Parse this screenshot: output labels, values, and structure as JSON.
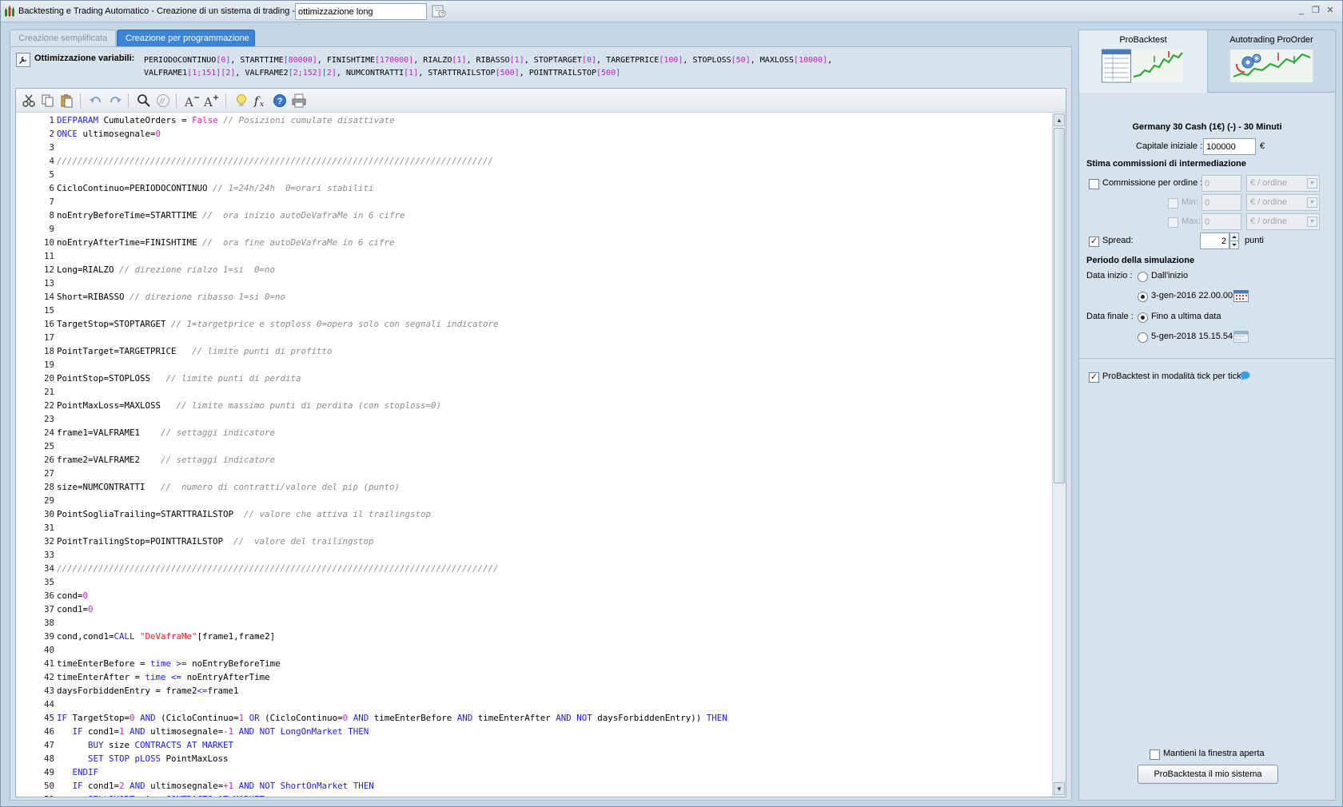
{
  "window": {
    "title": "Backtesting e Trading Automatico - Creazione di un sistema di trading  -",
    "system_name": "ottimizzazione long",
    "controls": {
      "minimize": "_",
      "restore": "❐",
      "close": "✕"
    }
  },
  "tabs": {
    "simple": "Creazione semplificata",
    "programming": "Creazione per programmazione"
  },
  "optimization": {
    "label": "Ottimizzazione variabili:",
    "vars": [
      {
        "name": "PERIODOCONTINUO",
        "value": "[0]"
      },
      {
        "name": "STARTTIME",
        "value": "[80000]"
      },
      {
        "name": "FINISHTIME",
        "value": "[170000]"
      },
      {
        "name": "RIALZO",
        "value": "[1]"
      },
      {
        "name": "RIBASSO",
        "value": "[1]"
      },
      {
        "name": "STOPTARGET",
        "value": "[0]"
      },
      {
        "name": "TARGETPRICE",
        "value": "[100]"
      },
      {
        "name": "STOPLOSS",
        "value": "[50]"
      },
      {
        "name": "MAXLOSS",
        "value": "[10000]"
      },
      {
        "name": "VALFRAME1",
        "value": "[1;151][2]"
      },
      {
        "name": "VALFRAME2",
        "value": "[2;152][2]"
      },
      {
        "name": "NUMCONTRATTI",
        "value": "[1]"
      },
      {
        "name": "STARTTRAILSTOP",
        "value": "[500]"
      },
      {
        "name": "POINTTRAILSTOP",
        "value": "[500]"
      }
    ]
  },
  "code_lines": [
    [
      [
        "kw",
        "DEFPARAM"
      ],
      [
        "t",
        " CumulateOrders "
      ],
      [
        "t",
        "="
      ],
      [
        "t",
        " "
      ],
      [
        "nm",
        "False"
      ],
      [
        "t",
        " "
      ],
      [
        "cm",
        "// Posizioni cumulate disattivate"
      ]
    ],
    [
      [
        "kw",
        "ONCE"
      ],
      [
        "t",
        " ultimosegnale="
      ],
      [
        "nm",
        "0"
      ]
    ],
    [],
    [
      [
        "cm",
        "////////////////////////////////////////////////////////////////////////////////////"
      ]
    ],
    [],
    [
      [
        "t",
        "CicloContinuo=PERIODOCONTINUO "
      ],
      [
        "cm",
        "// 1=24h/24h  0=orari stabiliti"
      ]
    ],
    [],
    [
      [
        "t",
        "noEntryBeforeTime=STARTTIME "
      ],
      [
        "cm",
        "//  ora inizio autoDeVafraMe in 6 cifre"
      ]
    ],
    [],
    [
      [
        "t",
        "noEntryAfterTime=FINISHTIME "
      ],
      [
        "cm",
        "//  ora fine autoDeVafraMe in 6 cifre"
      ]
    ],
    [],
    [
      [
        "t",
        "Long=RIALZO "
      ],
      [
        "cm",
        "// direzione rialzo 1=si  0=no"
      ]
    ],
    [],
    [
      [
        "t",
        "Short=RIBASSO "
      ],
      [
        "cm",
        "// direzione ribasso 1=si 0=no"
      ]
    ],
    [],
    [
      [
        "t",
        "TargetStop=STOPTARGET "
      ],
      [
        "cm",
        "// 1=targetprice e stoploss 0=opera solo con segnali indicatore"
      ]
    ],
    [],
    [
      [
        "t",
        "PointTarget=TARGETPRICE   "
      ],
      [
        "cm",
        "// limite punti di profitto"
      ]
    ],
    [],
    [
      [
        "t",
        "PointStop=STOPLOSS   "
      ],
      [
        "cm",
        "// limite punti di perdita"
      ]
    ],
    [],
    [
      [
        "t",
        "PointMaxLoss=MAXLOSS   "
      ],
      [
        "cm",
        "// limite massimo punti di perdita (con stoploss=0)"
      ]
    ],
    [],
    [
      [
        "t",
        "frame1=VALFRAME1    "
      ],
      [
        "cm",
        "// settaggi indicatore"
      ]
    ],
    [],
    [
      [
        "t",
        "frame2=VALFRAME2    "
      ],
      [
        "cm",
        "// settaggi indicatore"
      ]
    ],
    [],
    [
      [
        "t",
        "size=NUMCONTRATTI   "
      ],
      [
        "cm",
        "//  numero di contratti/valore del pip (punto)"
      ]
    ],
    [],
    [
      [
        "t",
        "PointSogliaTrailing=STARTTRAILSTOP  "
      ],
      [
        "cm",
        "// valore che attiva il trailingstop"
      ]
    ],
    [],
    [
      [
        "t",
        "PointTrailingStop=POINTTRAILSTOP  "
      ],
      [
        "cm",
        "//  valore del trailingstop"
      ]
    ],
    [],
    [
      [
        "cm",
        "/////////////////////////////////////////////////////////////////////////////////////"
      ]
    ],
    [],
    [
      [
        "t",
        "cond="
      ],
      [
        "nm",
        "0"
      ]
    ],
    [
      [
        "t",
        "cond1="
      ],
      [
        "nm",
        "0"
      ]
    ],
    [],
    [
      [
        "t",
        "cond,cond1="
      ],
      [
        "kw",
        "CALL"
      ],
      [
        "t",
        " "
      ],
      [
        "str",
        "\"DeVafraMe\""
      ],
      [
        "t",
        "[frame1,frame2]"
      ]
    ],
    [],
    [
      [
        "t",
        "timeEnterBefore = "
      ],
      [
        "kw",
        "time"
      ],
      [
        "t",
        " "
      ],
      [
        "kw",
        ">="
      ],
      [
        "t",
        " noEntryBeforeTime"
      ]
    ],
    [
      [
        "t",
        "timeEnterAfter = "
      ],
      [
        "kw",
        "time"
      ],
      [
        "t",
        " "
      ],
      [
        "kw",
        "<="
      ],
      [
        "t",
        " noEntryAfterTime"
      ]
    ],
    [
      [
        "t",
        "daysForbiddenEntry = frame2"
      ],
      [
        "kw",
        "<="
      ],
      [
        "t",
        "frame1"
      ]
    ],
    [],
    [
      [
        "kw",
        "IF"
      ],
      [
        "t",
        " TargetStop="
      ],
      [
        "nm",
        "0"
      ],
      [
        "t",
        " "
      ],
      [
        "kw",
        "AND"
      ],
      [
        "t",
        " (CicloContinuo="
      ],
      [
        "nm",
        "1"
      ],
      [
        "t",
        " "
      ],
      [
        "kw",
        "OR"
      ],
      [
        "t",
        " (CicloContinuo="
      ],
      [
        "nm",
        "0"
      ],
      [
        "t",
        " "
      ],
      [
        "kw",
        "AND"
      ],
      [
        "t",
        " timeEnterBefore "
      ],
      [
        "kw",
        "AND"
      ],
      [
        "t",
        " timeEnterAfter "
      ],
      [
        "kw",
        "AND NOT"
      ],
      [
        "t",
        " daysForbiddenEntry)) "
      ],
      [
        "kw",
        "THEN"
      ]
    ],
    [
      [
        "t",
        "   "
      ],
      [
        "kw",
        "IF"
      ],
      [
        "t",
        " cond1="
      ],
      [
        "nm",
        "1"
      ],
      [
        "t",
        " "
      ],
      [
        "kw",
        "AND"
      ],
      [
        "t",
        " ultimosegnale="
      ],
      [
        "nm",
        "-1"
      ],
      [
        "t",
        " "
      ],
      [
        "kw",
        "AND NOT"
      ],
      [
        "t",
        " "
      ],
      [
        "kw",
        "LongOnMarket"
      ],
      [
        "t",
        " "
      ],
      [
        "kw",
        "THEN"
      ]
    ],
    [
      [
        "t",
        "      "
      ],
      [
        "kw",
        "BUY"
      ],
      [
        "t",
        " size "
      ],
      [
        "kw",
        "CONTRACTS AT MARKET"
      ]
    ],
    [
      [
        "t",
        "      "
      ],
      [
        "kw",
        "SET STOP pLOSS"
      ],
      [
        "t",
        " PointMaxLoss"
      ]
    ],
    [
      [
        "t",
        "   "
      ],
      [
        "kw",
        "ENDIF"
      ]
    ],
    [
      [
        "t",
        "   "
      ],
      [
        "kw",
        "IF"
      ],
      [
        "t",
        " cond1="
      ],
      [
        "nm",
        "2"
      ],
      [
        "t",
        " "
      ],
      [
        "kw",
        "AND"
      ],
      [
        "t",
        " ultimosegnale="
      ],
      [
        "nm",
        "+1"
      ],
      [
        "t",
        " "
      ],
      [
        "kw",
        "AND NOT"
      ],
      [
        "t",
        " "
      ],
      [
        "kw",
        "ShortOnMarket"
      ],
      [
        "t",
        " "
      ],
      [
        "kw",
        "THEN"
      ]
    ],
    [
      [
        "t",
        "      "
      ],
      [
        "kw",
        "SELLSHORT"
      ],
      [
        "t",
        " size "
      ],
      [
        "kw",
        "CONTRACTS AT MARKET"
      ]
    ]
  ],
  "right": {
    "tab_probacktest": "ProBacktest",
    "tab_autotrading": "Autotrading ProOrder",
    "instrument": "Germany 30 Cash (1€) (-) - 30 Minuti",
    "capital_label": "Capitale iniziale :",
    "capital_value": "100000",
    "capital_currency": "€",
    "commissions_title": "Stima commissioni di intermediazione",
    "commission_label": "Commissione per ordine :",
    "commission_value": "0",
    "commission_unit": "€ / ordine",
    "min_label": "Min:",
    "min_value": "0",
    "min_unit": "€ / ordine",
    "max_label": "Max:",
    "max_value": "0",
    "max_unit": "€ / ordine",
    "spread_label": "Spread:",
    "spread_value": "2",
    "spread_unit": "punti",
    "period_title": "Periodo della simulazione",
    "start_label": "Data inizio :",
    "start_opt1": "Dall'inizio",
    "start_opt2": "3-gen-2016 22.00.00",
    "end_label": "Data finale :",
    "end_opt1": "Fino a ultima data",
    "end_opt2": "5-gen-2018 15.15.54",
    "tick_label": "ProBacktest in modalità tick per tick",
    "keep_open_label": "Mantieni la finestra aperta",
    "run_button": "ProBacktesta il mio sistema"
  }
}
